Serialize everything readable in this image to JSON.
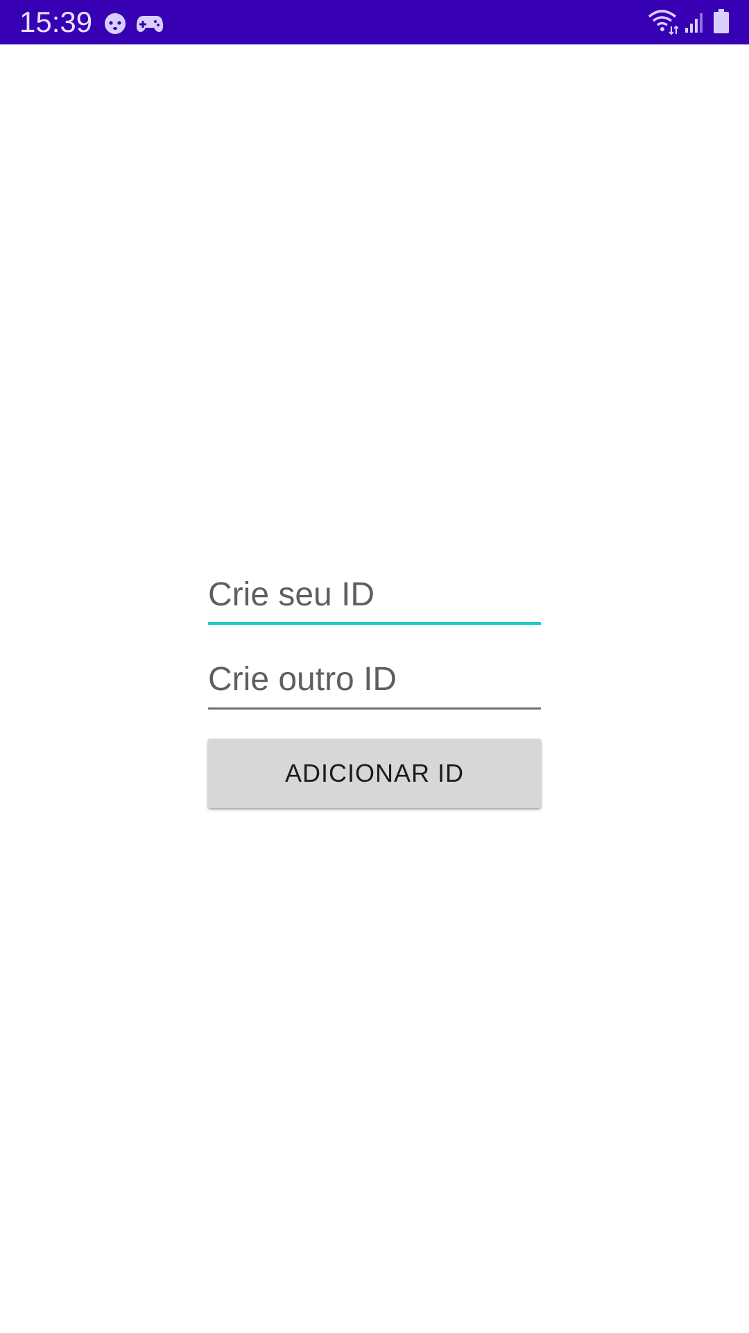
{
  "status_bar": {
    "time": "15:39",
    "background_color": "#3700b3",
    "notification_icons": [
      "face-icon",
      "gamepad-icon"
    ],
    "system_icons": [
      "wifi-icon",
      "cellular-signal-icon",
      "battery-icon"
    ]
  },
  "form": {
    "id_field": {
      "placeholder": "Crie seu ID",
      "value": "",
      "focused": true,
      "accent_color": "#1cc9c0"
    },
    "other_id_field": {
      "placeholder": "Crie outro ID",
      "value": ""
    },
    "add_button": {
      "label": "ADICIONAR ID",
      "background_color": "#d6d7d7"
    }
  }
}
